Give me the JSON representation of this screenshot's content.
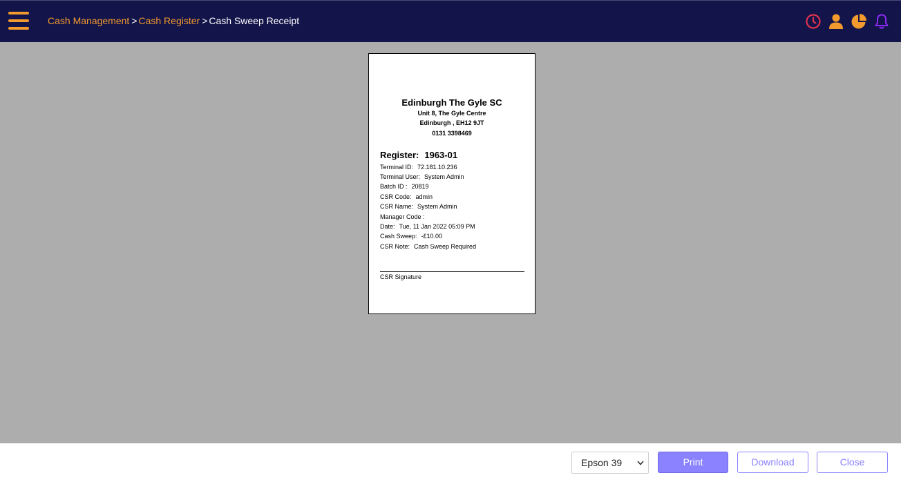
{
  "header": {
    "breadcrumb": [
      "Cash Management",
      "Cash Register",
      "Cash Sweep Receipt"
    ],
    "separator": ">",
    "icons": [
      "clock-icon",
      "user-icon",
      "pie-chart-icon",
      "bell-icon"
    ],
    "colors": {
      "bar": "#13144a",
      "accent": "#f29a2e",
      "clock": "#e0334f",
      "bell": "#8c2bf5"
    }
  },
  "receipt": {
    "store_name": "Edinburgh The Gyle SC",
    "address1": "Unit 8, The Gyle Centre",
    "address2": "Edinburgh , EH12 9JT",
    "phone": "0131 3398469",
    "register_label": "Register:",
    "register_value": "1963-01",
    "fields": [
      {
        "label": "Terminal ID:",
        "value": "72.181.10.236"
      },
      {
        "label": "Terminal User:",
        "value": "System Admin"
      },
      {
        "label": "Batch ID :",
        "value": "20819"
      },
      {
        "label": "CSR Code:",
        "value": "admin"
      },
      {
        "label": "CSR Name:",
        "value": "System Admin"
      },
      {
        "label": "Manager Code :",
        "value": ""
      },
      {
        "label": "Date:",
        "value": "Tue, 11 Jan 2022 05:09 PM"
      },
      {
        "label": "Cash Sweep:",
        "value": "-£10.00"
      },
      {
        "label": "CSR Note:",
        "value": "Cash Sweep Required"
      }
    ],
    "signature_label": "CSR Signature"
  },
  "footer": {
    "printer_selected": "Epson 39",
    "print_label": "Print",
    "download_label": "Download",
    "close_label": "Close",
    "button_color": "#8a82ff"
  }
}
